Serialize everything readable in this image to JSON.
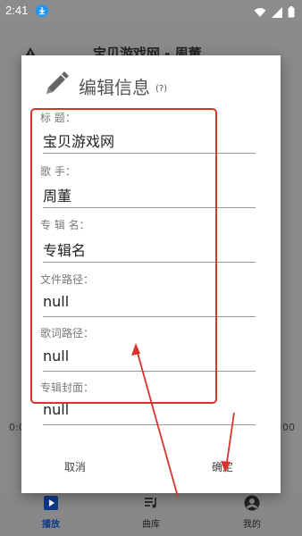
{
  "status_bar": {
    "time": "2:41"
  },
  "app": {
    "title": "宝贝游戏网 - 周董",
    "time_left": "0:0",
    "time_right": "00"
  },
  "nav": [
    {
      "label": "播放"
    },
    {
      "label": "曲库"
    },
    {
      "label": "我的"
    }
  ],
  "dialog": {
    "title": "编辑信息",
    "help": "(?)",
    "fields": [
      {
        "label": "标 题：",
        "value": "宝贝游戏网"
      },
      {
        "label": "歌 手：",
        "value": "周董"
      },
      {
        "label": "专 辑 名：",
        "value": "专辑名"
      },
      {
        "label": "文件路径：",
        "value": "null"
      },
      {
        "label": "歌词路径：",
        "value": "null"
      },
      {
        "label": "专辑封面：",
        "value": "null"
      }
    ],
    "cancel_label": "取消",
    "ok_label": "确定"
  },
  "colors": {
    "accent": "#0d3a8a",
    "annotation": "#d9342b"
  }
}
